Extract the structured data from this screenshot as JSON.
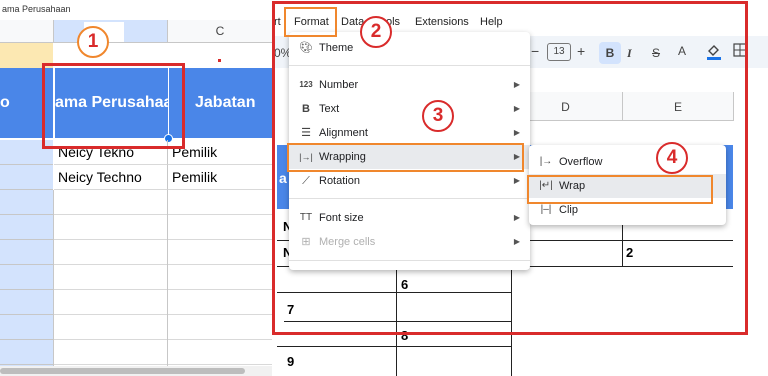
{
  "name_box": {
    "value": "ama Perusahaan"
  },
  "columns_left": {
    "c": "C"
  },
  "header_row": {
    "col_a": "o",
    "col_b": "ama Perusahaa",
    "col_c": "Jabatan"
  },
  "rows": [
    {
      "b": "Neicy Tekno",
      "c": "Pemilik"
    },
    {
      "b": "Neicy Techno",
      "c": "Pemilik"
    }
  ],
  "menubar": {
    "partial_left": "rt",
    "format": "Format",
    "data": "Data",
    "tools": "ols",
    "extensions": "Extensions",
    "help": "Help"
  },
  "toolbar": {
    "zoom_partial": "0%",
    "minus": "−",
    "font_size": "13",
    "plus": "+",
    "bold": "B",
    "italic": "I",
    "strike": "S",
    "text_color": "A",
    "fill_icon": "fill-color-icon",
    "borders_icon": "borders-icon"
  },
  "right_columns": {
    "d": "D",
    "e": "E"
  },
  "right_cells": {
    "n1": "N",
    "n2": "N",
    "two": "2",
    "six": "6",
    "seven": "7",
    "eight": "8",
    "nine": "9",
    "a_partial": "a"
  },
  "format_menu": {
    "items": [
      {
        "label": "Theme",
        "icon": "palette-icon",
        "submenu": false,
        "disabled": false
      },
      {
        "label": "Number",
        "icon": "123-icon",
        "submenu": true,
        "disabled": false
      },
      {
        "label": "Text",
        "icon": "bold-icon",
        "submenu": true,
        "disabled": false
      },
      {
        "label": "Alignment",
        "icon": "align-icon",
        "submenu": true,
        "disabled": false
      },
      {
        "label": "Wrapping",
        "icon": "wrap-icon",
        "submenu": true,
        "disabled": false
      },
      {
        "label": "Rotation",
        "icon": "rotation-icon",
        "submenu": true,
        "disabled": false
      },
      {
        "label": "Font size",
        "icon": "font-size-icon",
        "submenu": true,
        "disabled": false
      },
      {
        "label": "Merge cells",
        "icon": "merge-icon",
        "submenu": true,
        "disabled": true
      }
    ]
  },
  "wrapping_submenu": {
    "items": [
      {
        "label": "Overflow",
        "icon": "overflow-icon"
      },
      {
        "label": "Wrap",
        "icon": "wrap-icon"
      },
      {
        "label": "Clip",
        "icon": "clip-icon"
      }
    ]
  },
  "steps": {
    "one": "1",
    "two": "2",
    "three": "3",
    "four": "4"
  },
  "colors": {
    "header_blue": "#4a86e8",
    "highlight_red": "#d92b2b",
    "highlight_orange": "#f0872d",
    "row_header_blue": "#d3e3fd"
  }
}
